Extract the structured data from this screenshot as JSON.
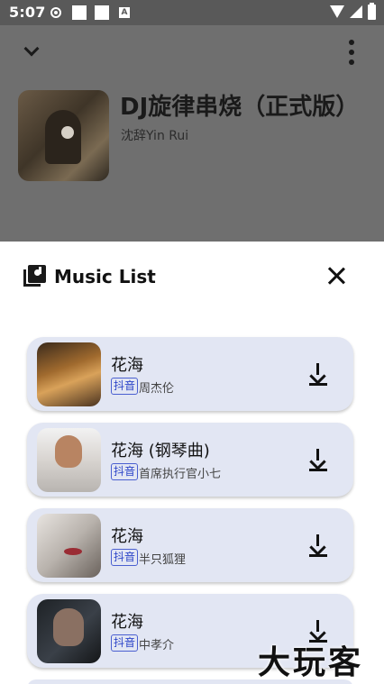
{
  "status_bar": {
    "time": "5:07",
    "icon_letter": "A"
  },
  "player": {
    "title": "DJ旋律串烧（正式版）",
    "artist": "沈辞Yin Rui"
  },
  "sheet": {
    "title": "Music List"
  },
  "songs": [
    {
      "title": "花海",
      "platform": "抖音",
      "artist": "周杰伦"
    },
    {
      "title": "花海 (钢琴曲)",
      "platform": "抖音",
      "artist": "首席执行官小七"
    },
    {
      "title": "花海",
      "platform": "抖音",
      "artist": "半只狐狸"
    },
    {
      "title": "花海",
      "platform": "抖音",
      "artist": "中孝介"
    }
  ],
  "watermark": {
    "text": "大玩客"
  },
  "icons": {
    "collapse": "chevron-down-icon",
    "more": "more-vert-icon",
    "list": "music-list-icon",
    "close": "close-icon",
    "download": "download-icon"
  },
  "colors": {
    "list_item_bg": "#e2e6f3",
    "platform_badge": "#2b44c8",
    "overlay": "#6f6f6f"
  }
}
